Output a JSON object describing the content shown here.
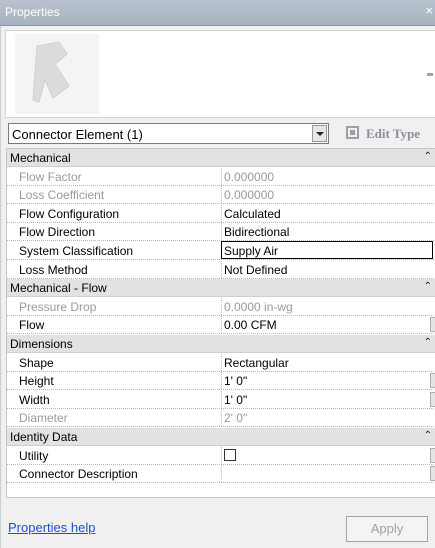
{
  "window": {
    "title": "Properties",
    "close_glyph": "×"
  },
  "type_selector": {
    "value": "Connector Element (1)",
    "edit_type_label": "Edit Type"
  },
  "sections": [
    {
      "label": "Mechanical",
      "collapse_glyph": "⌃",
      "rows": [
        {
          "name": "Flow Factor",
          "value": "0.000000",
          "disabled": true
        },
        {
          "name": "Loss Coefficient",
          "value": "0.000000",
          "disabled": true
        },
        {
          "name": "Flow Configuration",
          "value": "Calculated",
          "disabled": false
        },
        {
          "name": "Flow Direction",
          "value": "Bidirectional",
          "disabled": false
        },
        {
          "name": "System Classification",
          "value": "Supply Air",
          "disabled": false,
          "active": true
        },
        {
          "name": "Loss Method",
          "value": "Not Defined",
          "disabled": false
        }
      ]
    },
    {
      "label": "Mechanical - Flow",
      "collapse_glyph": "⌃",
      "rows": [
        {
          "name": "Pressure Drop",
          "value": "0.0000 in-wg",
          "disabled": true
        },
        {
          "name": "Flow",
          "value": "0.00 CFM",
          "disabled": false
        }
      ]
    },
    {
      "label": "Dimensions",
      "collapse_glyph": "⌃",
      "rows": [
        {
          "name": "Shape",
          "value": "Rectangular",
          "disabled": false
        },
        {
          "name": "Height",
          "value": "1'  0\"",
          "disabled": false
        },
        {
          "name": "Width",
          "value": "1'  0\"",
          "disabled": false
        },
        {
          "name": "Diameter",
          "value": "2'  0\"",
          "disabled": true
        }
      ]
    },
    {
      "label": "Identity Data",
      "collapse_glyph": "⌃",
      "rows": [
        {
          "name": "Utility",
          "value": "",
          "checkbox": true,
          "checked": false
        },
        {
          "name": "Connector Description",
          "value": "",
          "disabled": false
        }
      ]
    }
  ],
  "footer": {
    "help_link": "Properties help",
    "apply_label": "Apply"
  }
}
